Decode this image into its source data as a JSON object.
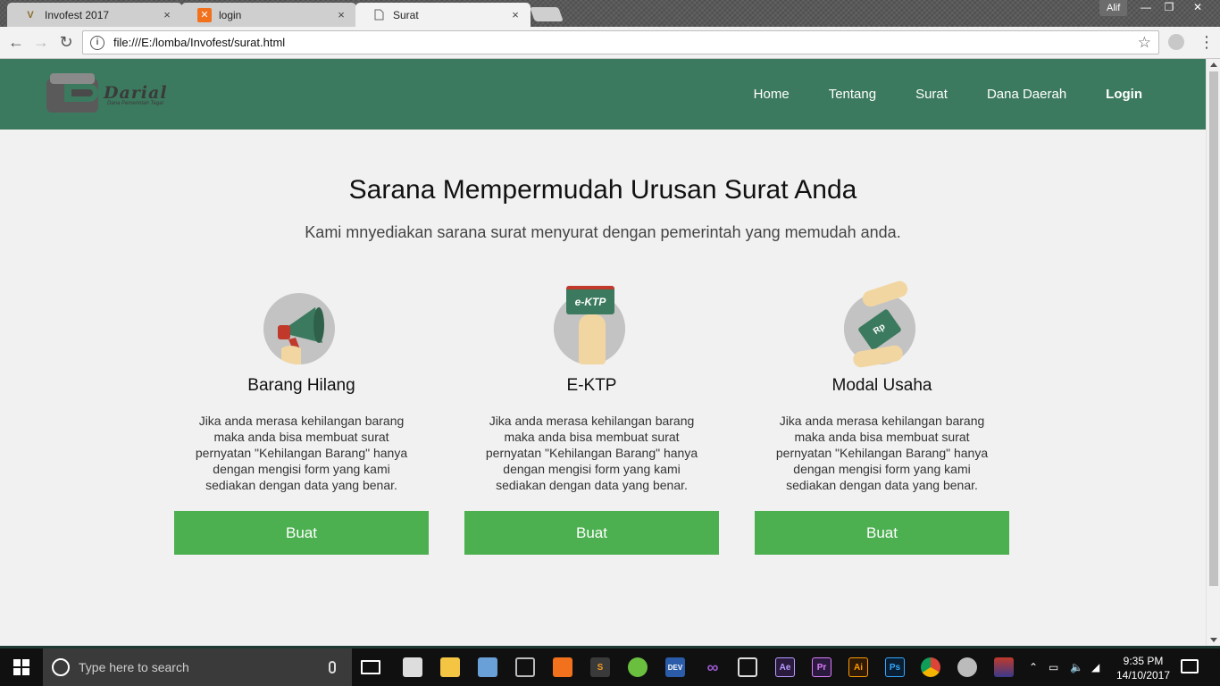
{
  "browser": {
    "tabs": [
      {
        "title": "Invofest 2017",
        "favicon": "invofest-favicon",
        "close": "×"
      },
      {
        "title": "login",
        "favicon": "xampp-favicon",
        "close": "×"
      },
      {
        "title": "Surat",
        "favicon": "page-favicon",
        "close": "×"
      }
    ],
    "profile": "Alif",
    "window_controls": {
      "minimize": "—",
      "maximize": "❐",
      "close": "✕"
    },
    "url": "file:///E:/lomba/Invofest/surat.html",
    "back": "←",
    "forward": "→",
    "reload": "↻",
    "info": "i",
    "star": "☆",
    "menu": "⋮"
  },
  "site": {
    "logo": {
      "name": "Darial",
      "tagline": "Dana Pemerintah Tegal"
    },
    "nav": [
      {
        "label": "Home"
      },
      {
        "label": "Tentang"
      },
      {
        "label": "Surat"
      },
      {
        "label": "Dana Daerah"
      },
      {
        "label": "Login"
      }
    ],
    "hero": {
      "title": "Sarana Mempermudah Urusan Surat Anda",
      "subtitle": "Kami mnyediakan sarana surat menyurat dengan pemerintah yang memudah anda."
    },
    "cards": [
      {
        "icon": "megaphone-icon",
        "title": "Barang Hilang",
        "text": "Jika anda merasa kehilangan barang maka anda bisa membuat surat pernyatan \"Kehilangan Barang\" hanya dengan mengisi form yang kami sediakan dengan data yang benar.",
        "button": "Buat"
      },
      {
        "icon": "id-card-icon",
        "title": "E-KTP",
        "icon_text": "e-KTP",
        "text": "Jika anda merasa kehilangan barang maka anda bisa membuat surat pernyatan \"Kehilangan Barang\" hanya dengan mengisi form yang kami sediakan dengan data yang benar.",
        "button": "Buat"
      },
      {
        "icon": "money-hands-icon",
        "title": "Modal Usaha",
        "icon_text": "Rp",
        "text": "Jika anda merasa kehilangan barang maka anda bisa membuat surat pernyatan \"Kehilangan Barang\" hanya dengan mengisi form yang kami sediakan dengan data yang benar.",
        "button": "Buat"
      }
    ],
    "colors": {
      "navbar": "#3c7a5f",
      "button": "#4caf50",
      "background": "#f1f1f1"
    }
  },
  "taskbar": {
    "search_placeholder": "Type here to search",
    "apps": [
      "task-view-icon",
      "store-icon",
      "file-explorer-icon",
      "virtualbox-icon",
      "3d-box-icon",
      "xampp-icon",
      "sublime-icon",
      "devcpp-icon",
      "devc-icon",
      "visual-studio-icon",
      "media-icon",
      "after-effects-icon",
      "premiere-icon",
      "illustrator-icon",
      "photoshop-icon",
      "chrome-icon",
      "drop-icon",
      "gambar-icon"
    ],
    "app_labels": {
      "dev": "DEV",
      "ae": "Ae",
      "pr": "Pr",
      "ai": "Ai",
      "ps": "Ps"
    },
    "time": "9:35 PM",
    "date": "14/10/2017"
  }
}
